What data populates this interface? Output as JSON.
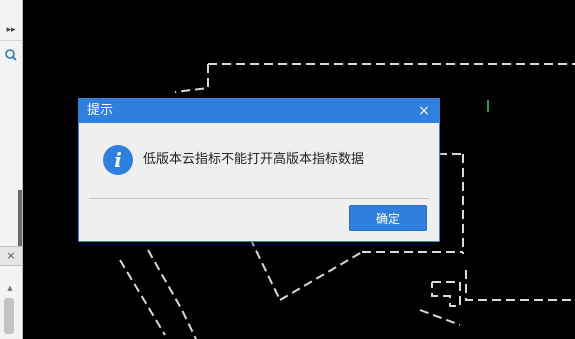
{
  "side_panel": {
    "expand_icon": "double-chevron-right-icon",
    "expand_glyph": "▸▸",
    "search_icon": "search-icon",
    "close_glyph": "×",
    "scroll_up_glyph": "▲"
  },
  "dialog": {
    "title": "提示",
    "close_glyph": "×",
    "icon": "info-icon",
    "icon_glyph": "i",
    "message": "低版本云指标不能打开高版本指标数据",
    "ok_label": "确定"
  },
  "colors": {
    "dialog_accent": "#2f7fde",
    "canvas_background": "#000000",
    "cad_lines": "#d9d9d9",
    "cad_accent_line": "#2ecc71"
  }
}
